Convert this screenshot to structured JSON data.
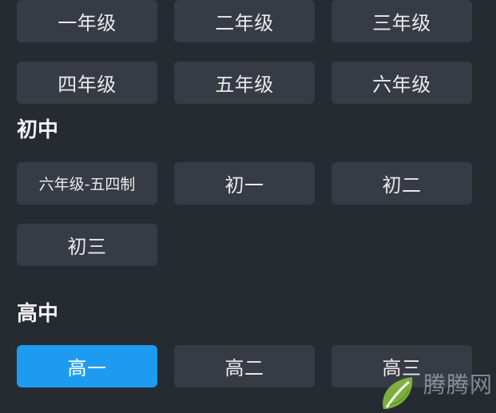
{
  "primary": {
    "grades": [
      "一年级",
      "二年级",
      "三年级",
      "四年级",
      "五年级",
      "六年级"
    ]
  },
  "junior": {
    "title": "初中",
    "grades": [
      "六年级-五四制",
      "初一",
      "初二",
      "初三"
    ]
  },
  "senior": {
    "title": "高中",
    "grades": [
      "高一",
      "高二",
      "高三"
    ],
    "selected": "高一"
  },
  "colors": {
    "background": "#262a31",
    "button": "#373b43",
    "selected": "#1d9bf0",
    "text": "#e9eaec"
  },
  "watermark": {
    "text": "腾腾网",
    "logo_icon": "leaf-logo-icon"
  }
}
